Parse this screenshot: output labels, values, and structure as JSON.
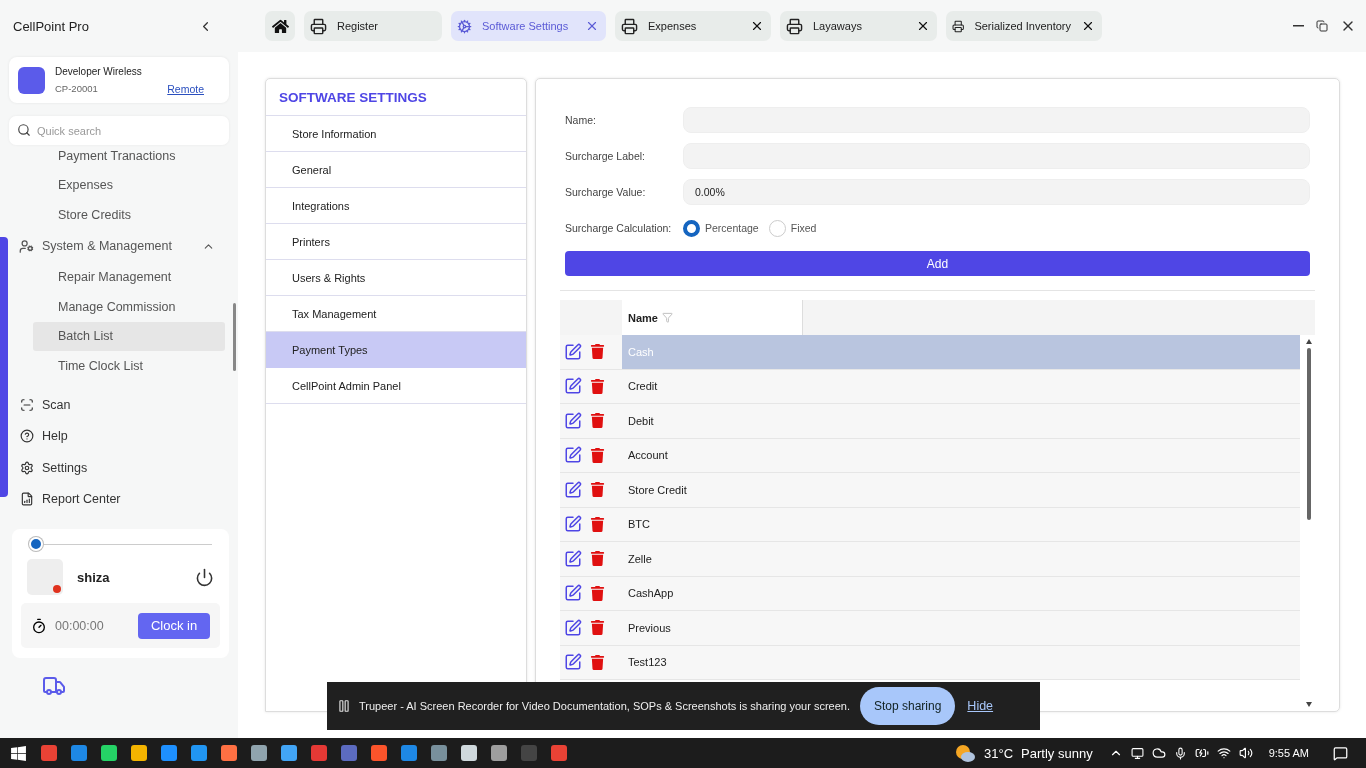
{
  "app": {
    "title": "CellPoint Pro"
  },
  "store": {
    "name": "Developer Wireless",
    "code": "CP-20001",
    "link": "Remote"
  },
  "search": {
    "placeholder": "Quick search"
  },
  "nav": [
    {
      "kind": "sub",
      "label": "Payment Tranactions",
      "selected": false
    },
    {
      "kind": "sub",
      "label": "Expenses",
      "selected": false
    },
    {
      "kind": "sub",
      "label": "Store Credits",
      "selected": false
    },
    {
      "kind": "group",
      "label": "System & Management",
      "expanded": true,
      "children": [
        {
          "label": "Repair Management",
          "selected": false
        },
        {
          "label": "Manage Commission",
          "selected": false
        },
        {
          "label": "Batch List",
          "selected": true
        },
        {
          "label": "Time Clock List",
          "selected": false
        }
      ]
    }
  ],
  "shortcuts": [
    {
      "kind": "scan",
      "label": "Scan"
    },
    {
      "kind": "help",
      "label": "Help"
    },
    {
      "kind": "settings",
      "label": "Settings"
    },
    {
      "kind": "report",
      "label": "Report Center"
    }
  ],
  "user": {
    "name": "shiza",
    "online": false,
    "slider": {
      "level": 0
    },
    "timer": "00:00:00",
    "clock_button": "Clock in"
  },
  "tabs": [
    {
      "kind": "printer",
      "label": "Register",
      "selected": false,
      "closable": false
    },
    {
      "kind": "settings",
      "label": "Software Settings",
      "selected": true,
      "closable": true
    },
    {
      "kind": "printer",
      "label": "Expenses",
      "selected": false,
      "closable": true
    },
    {
      "kind": "printer",
      "label": "Layaways",
      "selected": false,
      "closable": true
    },
    {
      "kind": "printer",
      "label": "Serialized Inventory",
      "selected": false,
      "closable": true
    }
  ],
  "settings_menu": {
    "title": "SOFTWARE SETTINGS",
    "items": [
      {
        "label": "Store Information",
        "selected": false
      },
      {
        "label": "General",
        "selected": false
      },
      {
        "label": "Integrations",
        "selected": false
      },
      {
        "label": "Printers",
        "selected": false
      },
      {
        "label": "Users & Rights",
        "selected": false
      },
      {
        "label": "Tax Management",
        "selected": false
      },
      {
        "label": "Payment Types",
        "selected": true
      },
      {
        "label": "CellPoint Admin Panel",
        "selected": false
      }
    ]
  },
  "form": {
    "fields": [
      {
        "label": "Name:"
      },
      {
        "label": "Surcharge Label:"
      },
      {
        "label": "Surcharge Value:",
        "value": "0.00%"
      }
    ],
    "calculation": {
      "label": "Surcharge Calculation:",
      "options": [
        {
          "label": "Percentage",
          "selected": true
        },
        {
          "label": "Fixed",
          "selected": false
        }
      ]
    },
    "add_button": "Add"
  },
  "table": {
    "columns": [
      "Name"
    ],
    "rows": [
      {
        "name": "Cash",
        "selected": true
      },
      {
        "name": "Credit",
        "selected": false
      },
      {
        "name": "Debit",
        "selected": false
      },
      {
        "name": "Account",
        "selected": false
      },
      {
        "name": "Store Credit",
        "selected": false
      },
      {
        "name": "BTC",
        "selected": false
      },
      {
        "name": "Zelle",
        "selected": false
      },
      {
        "name": "CashApp",
        "selected": false
      },
      {
        "name": "Previous",
        "selected": false
      },
      {
        "name": "Test123",
        "selected": false
      }
    ]
  },
  "share_bar": {
    "message": "Trupeer - AI Screen Recorder for Video Documentation, SOPs & Screenshots is sharing your screen.",
    "stop_button": "Stop sharing",
    "hide_link": "Hide"
  },
  "taskbar": {
    "temperature": "31°C",
    "weather": "Partly sunny",
    "time": "9:55 AM"
  }
}
